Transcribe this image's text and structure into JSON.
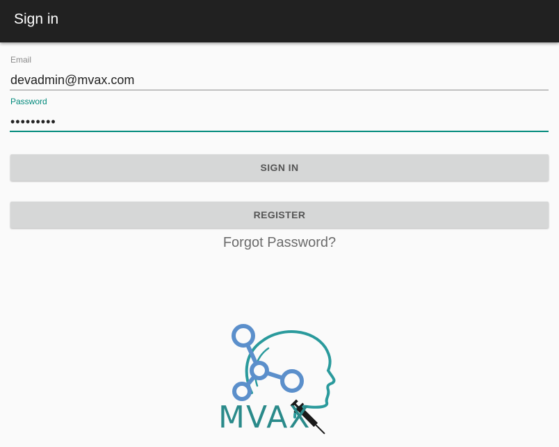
{
  "app_bar": {
    "title": "Sign in"
  },
  "form": {
    "email_label": "Email",
    "email_value": "devadmin@mvax.com",
    "password_label": "Password",
    "password_value": "•••••••••"
  },
  "buttons": {
    "sign_in": "SIGN IN",
    "register": "REGISTER"
  },
  "forgot_password": "Forgot Password?",
  "logo": {
    "text": "MVAX",
    "icon": "head-network-syringe-logo",
    "colors": {
      "teal": "#2a9a9c",
      "blue": "#5b8fcb",
      "dark": "#1a1a1a"
    }
  },
  "theme": {
    "app_bar_bg": "#212121",
    "accent": "#00897b",
    "background": "#fafafa",
    "button_bg": "#d6d7d7"
  }
}
